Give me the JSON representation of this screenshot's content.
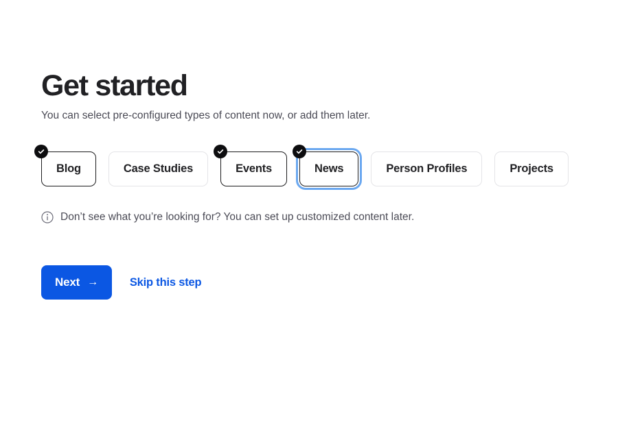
{
  "page": {
    "heading": "Get started",
    "subtitle": "You can select pre-configured types of content now, or add them later.",
    "background_color": "#ffffff"
  },
  "content_types": {
    "chips": [
      {
        "label": "Blog",
        "selected": true,
        "focused": false
      },
      {
        "label": "Case Studies",
        "selected": false,
        "focused": false
      },
      {
        "label": "Events",
        "selected": true,
        "focused": false
      },
      {
        "label": "News",
        "selected": true,
        "focused": true
      },
      {
        "label": "Person Profiles",
        "selected": false,
        "focused": false
      },
      {
        "label": "Projects",
        "selected": false,
        "focused": false
      }
    ],
    "check_icon": "check-icon",
    "selected_border_color": "#1c1c1e",
    "unselected_border_color": "#e4e4e7",
    "badge_color": "#0d0d0f",
    "focus_ring_color": "#6ba8f0"
  },
  "note": {
    "icon": "info-icon",
    "text": "Don’t see what you’re looking for? You can set up customized content later.",
    "text_color": "#4a4a55"
  },
  "actions": {
    "next_label": "Next",
    "next_arrow": "→",
    "next_color": "#0b57e3",
    "skip_label": "Skip this step",
    "skip_color": "#0b57e3"
  }
}
